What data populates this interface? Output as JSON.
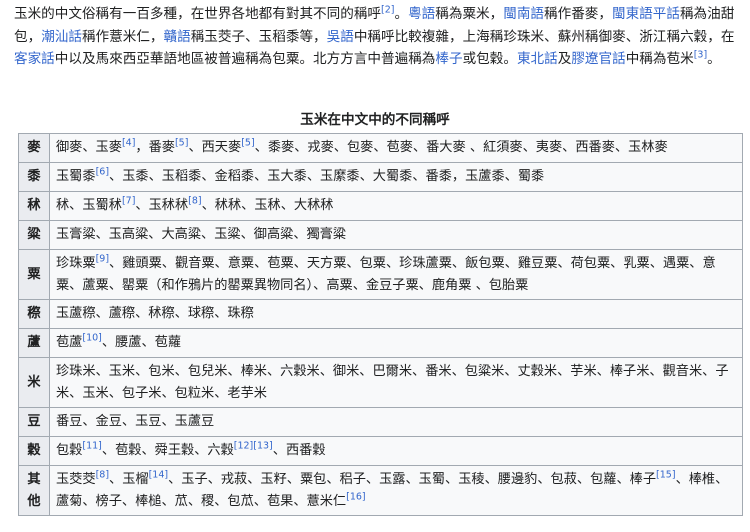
{
  "intro": {
    "p1": "玉米的中文俗稱有一百多種，在世界各地都有對其不同的稱呼",
    "ref2": "[2]",
    "p2": "。",
    "link_yue": "粵語",
    "p3": "稱為粟米，",
    "link_minnan": "閩南語",
    "p4": "稱作番麥，",
    "link_mindong": "閩東語平話",
    "p5": "稱為油甜包，",
    "link_chaoshan": "潮汕話",
    "p6": "稱作薏米仁，",
    "link_ganyu": "贛語",
    "p7": "稱玉茭子、玉稻黍等，",
    "link_wu": "吳語",
    "p8": "中稱呼比較複雜，上海稱珍珠米、蘇州稱御麥、浙江稱六穀，在",
    "link_hakka": "客家話",
    "p9": "中以及馬來西亞華語地區被普遍稱為包粟。北方方言中普遍稱為",
    "link_bangzi": "棒子",
    "p10": "或包穀。",
    "link_dongbei": "東北話",
    "p11": "及",
    "link_jiaoliao": "膠遼官話",
    "p12": "中稱為苞米",
    "ref3": "[3]",
    "p13": "。"
  },
  "table": {
    "caption": "玉米在中文中的不同稱呼",
    "rows": [
      {
        "head": "麥",
        "t1": "御麥、玉麥",
        "r1": "[4]",
        "t2": "，番麥",
        "r2": "[5]",
        "t3": "、西天麥",
        "r3": "[5]",
        "t4": "、黍麥、戎麥、包麥、苞麥、番大麥 、紅須麥、夷麥、西番麥、玉林麥"
      },
      {
        "head": "黍",
        "t1": "玉蜀黍",
        "r1": "[6]",
        "t2": "、玉黍、玉稻黍、金稻黍、玉大黍、玉縻黍、大蜀黍、番黍，玉蘆黍、蜀黍"
      },
      {
        "head": "秫",
        "t1": "秫、玉蜀秫",
        "r1": "[7]",
        "t2": "、玉秫秫",
        "r2": "[8]",
        "t3": "、秫秫、玉秫、大秫秫"
      },
      {
        "head": "粱",
        "t1": "玉膏粱、玉高粱、大高粱、玉粱、御高粱、獨膏粱"
      },
      {
        "head": "粟",
        "t1": "珍珠粟",
        "r1": "[9]",
        "t2": "、雞頭粟、觀音粟、意粟、苞粟、天方粟、包粟、珍珠蘆粟、飯包粟、雞豆粟、荷包粟、乳粟、遇粟、意粟、蘆粟、罌粟（和作鴉片的罌粟異物同名）、高粟、金豆子粟、鹿角粟 、包胎粟"
      },
      {
        "head": "穄",
        "t1": "玉蘆穄、蘆穄、秫穄、球穄、珠穄"
      },
      {
        "head": "蘆",
        "t1": "苞蘆",
        "r1": "[10]",
        "t2": "、腰蘆、苞蘿"
      },
      {
        "head": "米",
        "t1": "珍珠米、玉米、包米、包兒米、棒米、六穀米、御米、巴爾米、番米、包粱米、丈穀米、芋米、棒子米、觀音米、子米、玉米、包子米、包粒米、老芋米"
      },
      {
        "head": "豆",
        "t1": "番豆、金豆、玉豆、玉蘆豆"
      },
      {
        "head": "穀",
        "t1": "包穀",
        "r1": "[11]",
        "t2": "、苞穀、舜王穀、六穀",
        "r2": "[12][13]",
        "t3": "、西番穀"
      },
      {
        "head": "其他",
        "t1": "玉茭茭",
        "r1": "[8]",
        "t2": "、玉榴",
        "r2": "[14]",
        "t3": "、玉子、戎菽、玉籽、粟包、稆子、玉露、玉蜀、玉稜、腰邊豹、包菽、包蘿、棒子",
        "r3": "[15]",
        "t4": "、棒椎、蘆菊、榜子、棒槌、苽、稷、包苽、苞果、薏米仁",
        "r4": "[16]"
      }
    ]
  }
}
